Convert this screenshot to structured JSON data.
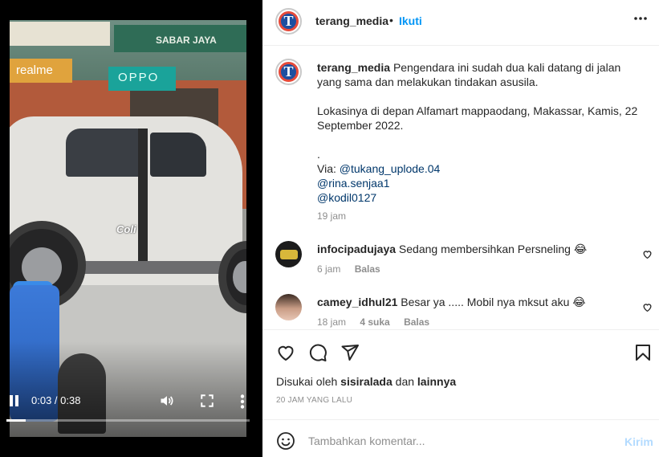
{
  "video": {
    "sign_sabar": "SABAR JAYA",
    "sign_realme": "realme",
    "sign_oppo": "OPPO",
    "watermark": "Coli",
    "time_display": "0:03 / 0:38",
    "progress_fraction": 0.079,
    "icons": [
      "pause-icon",
      "volume-icon",
      "fullscreen-icon",
      "more-vertical-icon"
    ]
  },
  "post": {
    "username": "terang_media",
    "dot": "•",
    "follow_label": "Ikuti",
    "more_icon": "more-horizontal-icon"
  },
  "caption": {
    "username": "terang_media",
    "text": "Pengendara ini sudah dua kali datang di jalan yang sama dan melakukan tindakan asusila.\n\nLokasinya di depan Alfamart mappaodang, Makassar, Kamis, 22 September 2022.\n\n.\nVia: ",
    "mentions": [
      "@tukang_uplode.04",
      "@rina.senjaa1",
      "@kodil0127"
    ],
    "time": "19 jam"
  },
  "comments": [
    {
      "username": "infocipadujaya",
      "text": "Sedang membersihkan Persneling 😂",
      "time": "6 jam",
      "likes": "",
      "reply_label": "Balas"
    },
    {
      "username": "camey_idhul21",
      "text": "Besar ya ..... Mobil nya mksut aku 😂",
      "time": "18 jam",
      "likes": "4 suka",
      "reply_label": "Balas"
    }
  ],
  "actions": {
    "icons": [
      "heart-icon",
      "comment-icon",
      "share-icon",
      "bookmark-icon"
    ],
    "liked_by_prefix": "Disukai oleh ",
    "liked_by_user": "sisiralada",
    "liked_by_mid": " dan ",
    "liked_by_others": "lainnya",
    "posted_time": "20 JAM YANG LALU"
  },
  "add_comment": {
    "placeholder": "Tambahkan komentar...",
    "post_label": "Kirim"
  },
  "colors": {
    "accent": "#0095f6",
    "link": "#00376b",
    "muted": "#8e8e8e",
    "post_disabled": "#b3dbff"
  }
}
